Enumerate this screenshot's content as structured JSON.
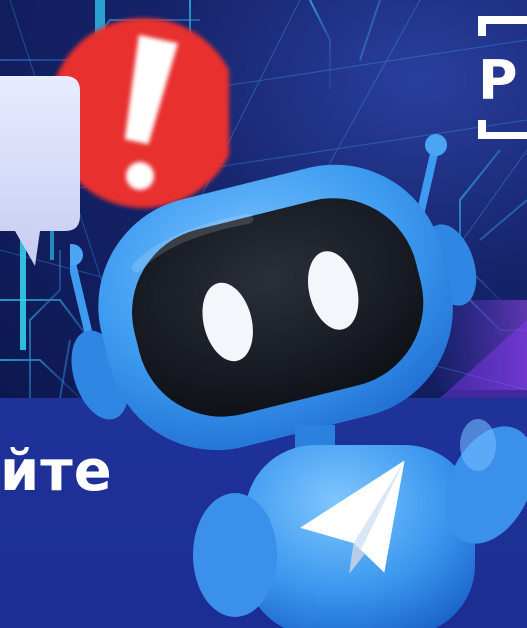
{
  "caption": {
    "text": "йте"
  },
  "brand": {
    "text": "Р"
  },
  "colors": {
    "robot_blue": "#3d9bf0",
    "robot_dark": "#161a22",
    "alert_red": "#e8302f",
    "banner_blue": "#1d2f95"
  },
  "icons": {
    "robot": "robot-illustration",
    "alert": "exclamation-icon",
    "plane": "paper-plane-icon",
    "bubble": "speech-bubble-icon"
  }
}
